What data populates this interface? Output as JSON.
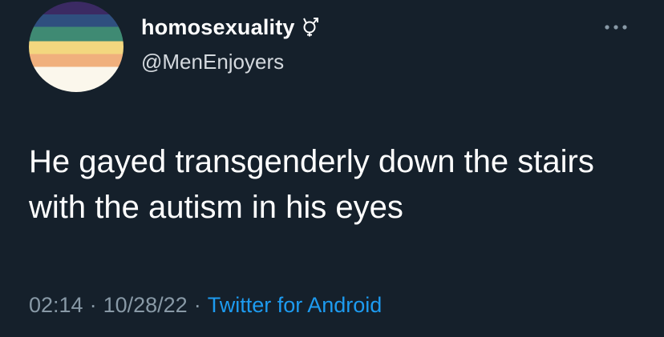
{
  "tweet": {
    "display_name": "homosexuality",
    "name_icon": "mars-venus-symbol-icon",
    "handle": "@MenEnjoyers",
    "avatar_icon": "pride-stripes-avatar",
    "more_icon": "more-dots-icon",
    "text": "He gayed transgenderly down the stairs with the autism in his eyes",
    "time": "02:14",
    "date": "10/28/22",
    "separator": "·",
    "source": "Twitter for Android"
  },
  "colors": {
    "background": "#15202b",
    "text": "#ffffff",
    "muted": "#8899a6",
    "link": "#1d9bf0"
  }
}
